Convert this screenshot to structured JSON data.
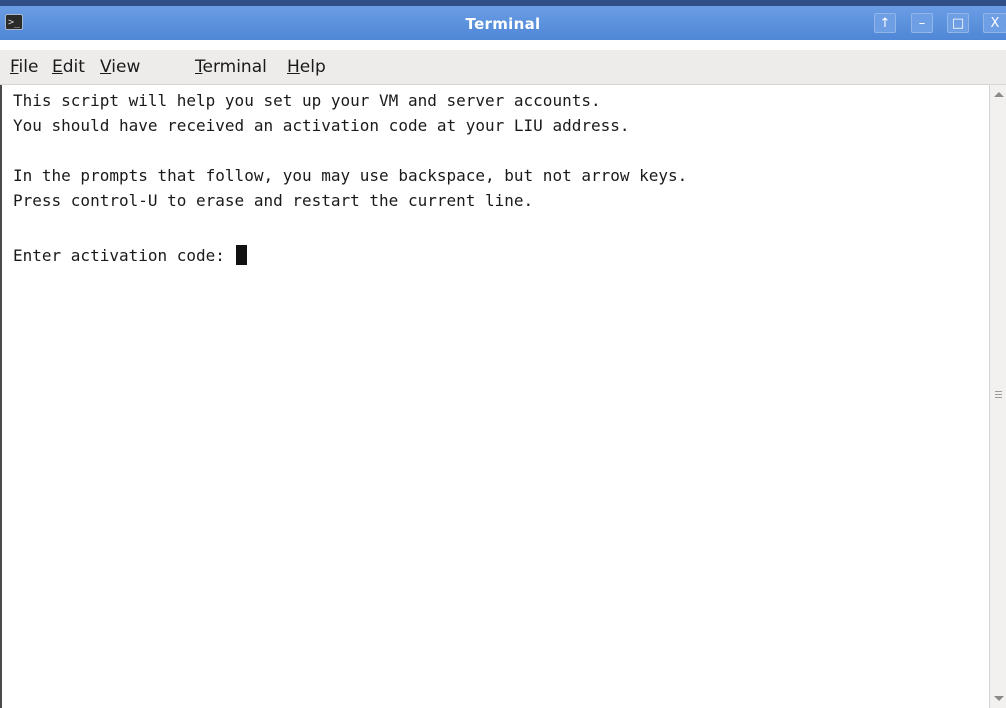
{
  "window": {
    "title": "Terminal",
    "icon": "terminal-icon",
    "controls": {
      "up_icon": "↑",
      "minimize_icon": "–",
      "maximize_icon": "□",
      "close_icon": "X"
    }
  },
  "menubar": {
    "items": [
      {
        "mnemonic": "F",
        "rest": "ile"
      },
      {
        "mnemonic": "E",
        "rest": "dit"
      },
      {
        "mnemonic": "V",
        "rest": "iew"
      },
      {
        "mnemonic": "T",
        "rest": "erminal"
      },
      {
        "mnemonic": "H",
        "rest": "elp"
      }
    ]
  },
  "terminal": {
    "lines": [
      "This script will help you set up your VM and server accounts.",
      "You should have received an activation code at your LIU address.",
      "",
      "In the prompts that follow, you may use backspace, but not arrow keys.",
      "Press control-U to erase and restart the current line.",
      "",
      "Enter activation code: "
    ]
  },
  "colors": {
    "titlebar": "#5a8fdc",
    "menubar": "#edeceb",
    "terminal_bg": "#ffffff",
    "text": "#1a1a1a"
  }
}
